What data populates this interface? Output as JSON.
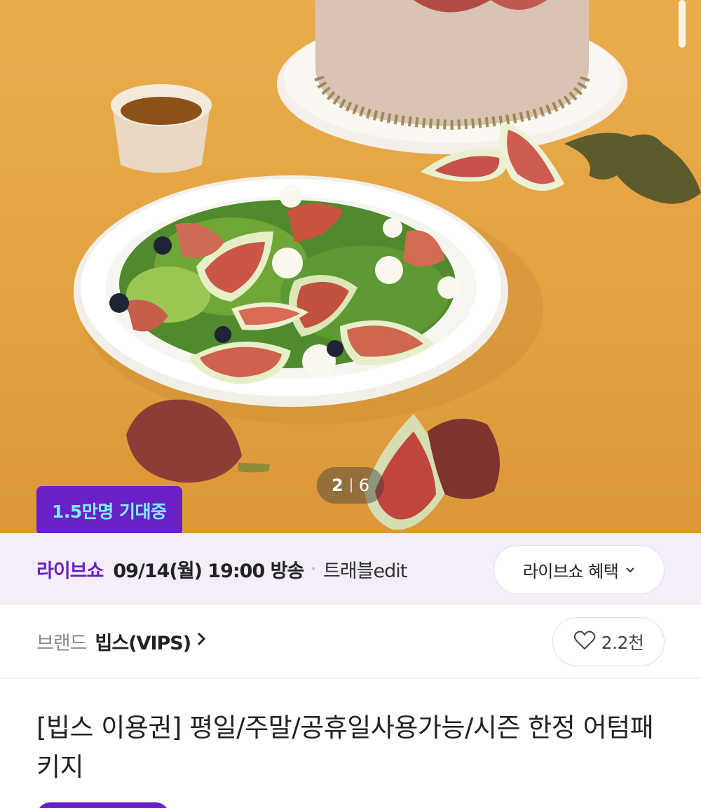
{
  "hero": {
    "pager": {
      "current": "2",
      "total": "6"
    },
    "expect_badge": "1.5만명 기대중",
    "colors": {
      "background": "#e5a444",
      "accent": "#6a1fc7"
    }
  },
  "live_bar": {
    "label": "라이브쇼",
    "date": "09/14(월) 19:00 방송",
    "separator": "·",
    "channel": "트래블edit",
    "benefit_button": "라이브쇼 혜택"
  },
  "brand_row": {
    "prefix": "브랜드",
    "name": "빕스(VIPS)",
    "like_count": "2.2천"
  },
  "product": {
    "title": "[빕스 이용권] 평일/주말/공휴일사용가능/시즌 한정 어텀패키지"
  }
}
